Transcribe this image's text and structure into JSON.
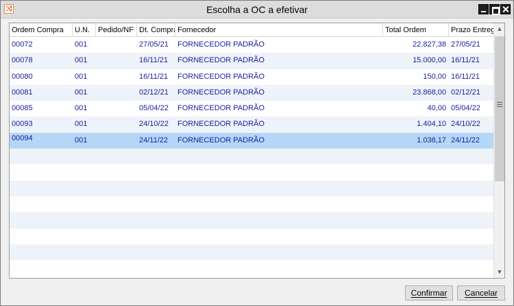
{
  "window": {
    "title": "Escolha a OC a efetivar",
    "app_icon": "shuffle-icon"
  },
  "grid": {
    "columns": [
      "Ordem Compra",
      "U.N.",
      "Pedido/NF",
      "Dt. Compra",
      "Fornecedor",
      "Total Ordem",
      "Prazo Entrega"
    ],
    "rows": [
      {
        "ordem": "00072",
        "un": "001",
        "pedido": "",
        "dt_compra": "27/05/21",
        "fornecedor": "FORNECEDOR PADRÃO",
        "total": "22.827,38",
        "prazo": "27/05/21"
      },
      {
        "ordem": "00078",
        "un": "001",
        "pedido": "",
        "dt_compra": "16/11/21",
        "fornecedor": "FORNECEDOR PADRÃO",
        "total": "15.000,00",
        "prazo": "16/11/21"
      },
      {
        "ordem": "00080",
        "un": "001",
        "pedido": "",
        "dt_compra": "16/11/21",
        "fornecedor": "FORNECEDOR PADRÃO",
        "total": "150,00",
        "prazo": "16/11/21"
      },
      {
        "ordem": "00081",
        "un": "001",
        "pedido": "",
        "dt_compra": "02/12/21",
        "fornecedor": "FORNECEDOR PADRÃO",
        "total": "23.868,00",
        "prazo": "02/12/21"
      },
      {
        "ordem": "00085",
        "un": "001",
        "pedido": "",
        "dt_compra": "05/04/22",
        "fornecedor": "FORNECEDOR PADRÃO",
        "total": "40,00",
        "prazo": "05/04/22"
      },
      {
        "ordem": "00093",
        "un": "001",
        "pedido": "",
        "dt_compra": "24/10/22",
        "fornecedor": "FORNECEDOR PADRÃO",
        "total": "1.404,10",
        "prazo": "24/10/22"
      },
      {
        "ordem": "00094",
        "un": "001",
        "pedido": "",
        "dt_compra": "24/11/22",
        "fornecedor": "FORNECEDOR PADRÃO",
        "total": "1.038,17",
        "prazo": "24/11/22"
      }
    ],
    "selected_row": 6,
    "empty_rows": 8
  },
  "buttons": {
    "confirm": "Confirmar",
    "cancel": "Cancelar"
  },
  "colors": {
    "cell_text": "#1a1aa0",
    "selected_row": "#b5d7f7",
    "alt_row": "#eef3f9"
  }
}
